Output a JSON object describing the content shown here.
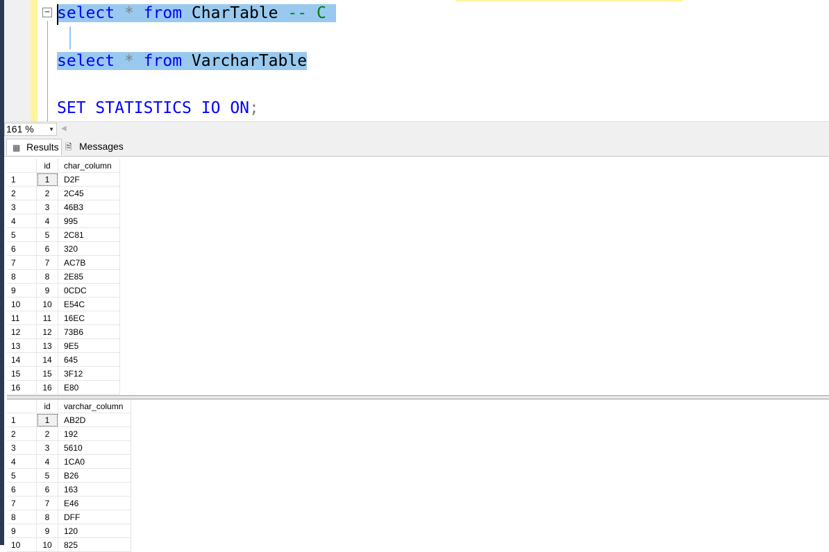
{
  "editor": {
    "lines": [
      [
        {
          "t": "select",
          "c": "kw"
        },
        {
          "t": " ",
          "c": "id"
        },
        {
          "t": "*",
          "c": "op"
        },
        {
          "t": " ",
          "c": "id"
        },
        {
          "t": "from",
          "c": "kw"
        },
        {
          "t": " CharTable ",
          "c": "id"
        },
        {
          "t": "--",
          "c": "cm"
        },
        {
          "t": " C ",
          "c": "cm"
        }
      ],
      [],
      [
        {
          "t": "select",
          "c": "kw"
        },
        {
          "t": " ",
          "c": "id"
        },
        {
          "t": "*",
          "c": "op"
        },
        {
          "t": " ",
          "c": "id"
        },
        {
          "t": "from",
          "c": "kw"
        },
        {
          "t": " VarcharTable",
          "c": "id"
        }
      ],
      [],
      [
        {
          "t": "SET",
          "c": "kw"
        },
        {
          "t": " ",
          "c": "id"
        },
        {
          "t": "STATISTICS",
          "c": "kw"
        },
        {
          "t": " ",
          "c": "id"
        },
        {
          "t": "IO",
          "c": "kw"
        },
        {
          "t": " ",
          "c": "id"
        },
        {
          "t": "ON",
          "c": "kw"
        },
        {
          "t": ";",
          "c": "op"
        }
      ]
    ],
    "selected_lines": [
      0,
      2
    ],
    "fold_symbol": "−"
  },
  "status": {
    "zoom": "161 %"
  },
  "tabs": {
    "results": "Results",
    "messages": "Messages"
  },
  "grids": [
    {
      "headers": [
        "id",
        "char_column"
      ],
      "rows": [
        [
          "1",
          "1",
          "D2F"
        ],
        [
          "2",
          "2",
          "2C45"
        ],
        [
          "3",
          "3",
          "46B3"
        ],
        [
          "4",
          "4",
          "995"
        ],
        [
          "5",
          "5",
          "2C81"
        ],
        [
          "6",
          "6",
          "320"
        ],
        [
          "7",
          "7",
          "AC7B"
        ],
        [
          "8",
          "8",
          "2E85"
        ],
        [
          "9",
          "9",
          "0CDC"
        ],
        [
          "10",
          "10",
          "E54C"
        ],
        [
          "11",
          "11",
          "16EC"
        ],
        [
          "12",
          "12",
          "73B6"
        ],
        [
          "13",
          "13",
          "9E5"
        ],
        [
          "14",
          "14",
          "645"
        ],
        [
          "15",
          "15",
          "3F12"
        ],
        [
          "16",
          "16",
          "E80"
        ]
      ]
    },
    {
      "headers": [
        "id",
        "varchar_column"
      ],
      "rows": [
        [
          "1",
          "1",
          "AB2D"
        ],
        [
          "2",
          "2",
          "192"
        ],
        [
          "3",
          "3",
          "5610"
        ],
        [
          "4",
          "4",
          "1CA0"
        ],
        [
          "5",
          "5",
          "B26"
        ],
        [
          "6",
          "6",
          "163"
        ],
        [
          "7",
          "7",
          "E46"
        ],
        [
          "8",
          "8",
          "DFF"
        ],
        [
          "9",
          "9",
          "120"
        ],
        [
          "10",
          "10",
          "825"
        ]
      ]
    }
  ]
}
